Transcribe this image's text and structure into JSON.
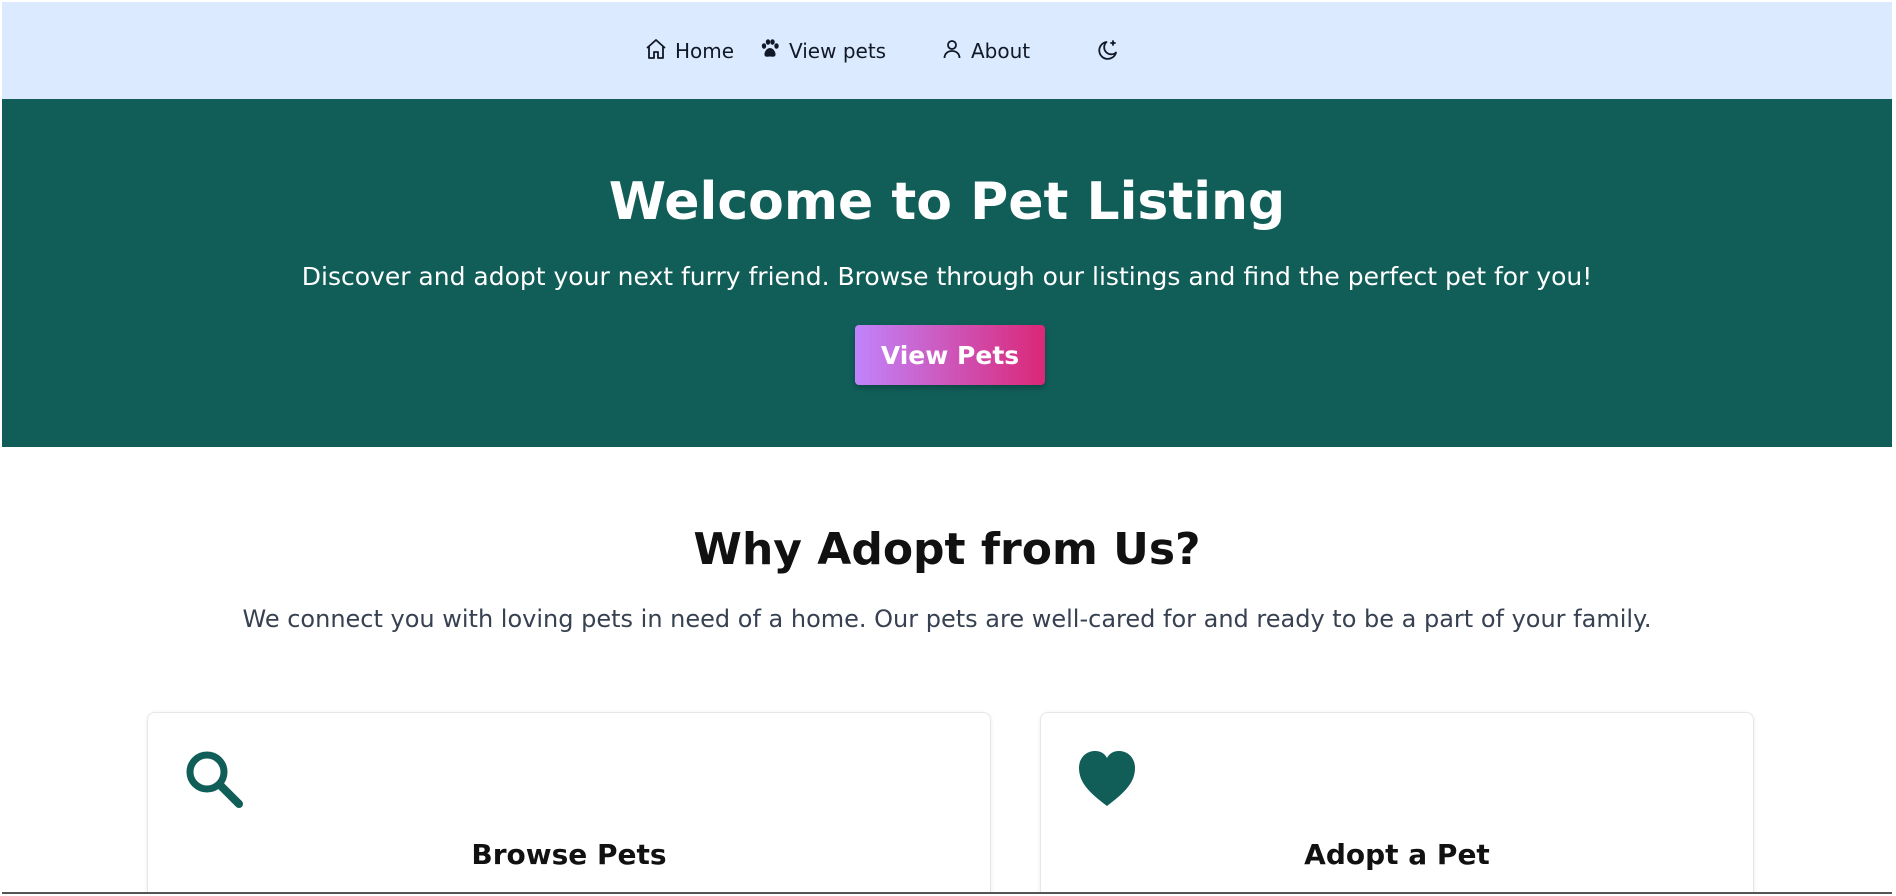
{
  "nav": {
    "items": [
      {
        "label": "Home",
        "icon": "home-icon"
      },
      {
        "label": "View pets",
        "icon": "paw-icon"
      },
      {
        "label": "About",
        "icon": "user-icon"
      }
    ],
    "theme_toggle_icon": "moon-icon"
  },
  "hero": {
    "title": "Welcome to Pet Listing",
    "subtitle": "Discover and adopt your next furry friend. Browse through our listings and find the perfect pet for you!",
    "button_label": "View Pets"
  },
  "why": {
    "title": "Why Adopt from Us?",
    "subtitle": "We connect you with loving pets in need of a home. Our pets are well-cared for and ready to be a part of your family."
  },
  "features": [
    {
      "title": "Browse Pets",
      "icon": "search-icon"
    },
    {
      "title": "Adopt a Pet",
      "icon": "heart-icon"
    }
  ],
  "colors": {
    "nav_bg": "#dbeafe",
    "hero_bg": "#115e59",
    "accent": "#115e59",
    "button_gradient_start": "#c084fc",
    "button_gradient_end": "#db2777"
  }
}
